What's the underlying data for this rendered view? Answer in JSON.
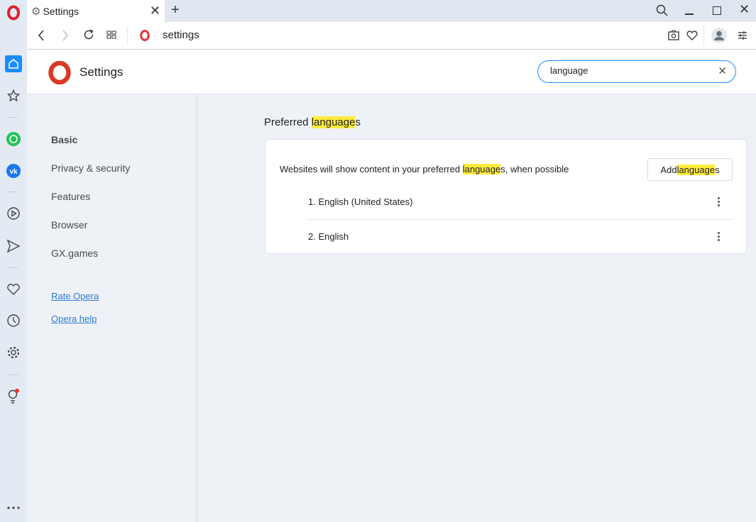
{
  "tab": {
    "title": "Settings",
    "icon": "gear-icon"
  },
  "toolbar": {
    "address": "settings"
  },
  "header": {
    "title": "Settings"
  },
  "search": {
    "value": "language",
    "placeholder": ""
  },
  "nav": {
    "items": [
      {
        "label": "Basic",
        "active": true
      },
      {
        "label": "Privacy & security"
      },
      {
        "label": "Features"
      },
      {
        "label": "Browser"
      },
      {
        "label": "GX.games"
      }
    ],
    "links": [
      {
        "label": "Rate Opera"
      },
      {
        "label": "Opera help"
      }
    ]
  },
  "section": {
    "title_pre": "Preferred ",
    "title_hl": "language",
    "title_post": "s",
    "desc_pre": "Websites will show content in your preferred ",
    "desc_hl": "language",
    "desc_post": "s, when possible",
    "add_pre": "Add ",
    "add_hl": "language",
    "add_post": "s",
    "languages": [
      {
        "label": "1. English (United States)"
      },
      {
        "label": "2. English"
      }
    ]
  },
  "colors": {
    "accent": "#1a8cff",
    "highlight": "#ffeb3b",
    "opera_red": "#e0202e"
  }
}
